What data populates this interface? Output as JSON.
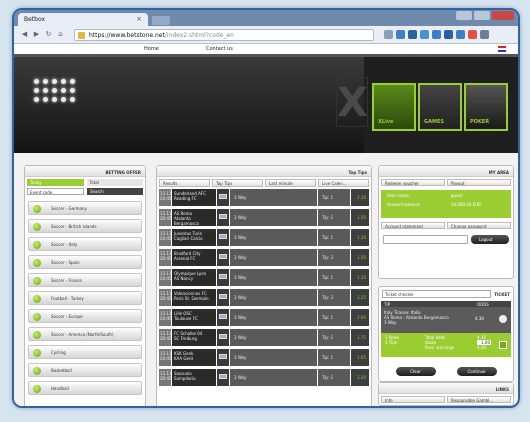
{
  "browser": {
    "tab_title": "Betbox",
    "url_host": "https://www.betstone.net",
    "url_path": "/index2.shtml?code_en"
  },
  "topnav": {
    "home": "Home",
    "contact": "Contact us"
  },
  "banner": {
    "promos": [
      "XLive",
      "GAMES",
      "POKER"
    ]
  },
  "left": {
    "title": "BETTING OFFER",
    "radio_on": "Today",
    "radio_off": "Total",
    "search_label": "Event code",
    "search_button": "Search",
    "sports": [
      "Soccer - Germany",
      "Soccer - British Islands",
      "Soccer - Italy",
      "Soccer - Spain",
      "Soccer - France",
      "Football - Turkey",
      "Soccer - Europe",
      "Soccer - America (North/South)",
      "Cycling",
      "Basketball",
      "Handball"
    ]
  },
  "middle": {
    "title": "Top Tips",
    "tabs": [
      "Results",
      "Top Tips",
      "Last minute",
      "Live Calen..."
    ],
    "matches": [
      {
        "date": "13.11.",
        "time": "20:45",
        "t1": "Sunderland AFC",
        "t2": "Reading FC",
        "sel": "3 Way",
        "tip": "Tip: 1",
        "odd": "2.10"
      },
      {
        "date": "13.11.",
        "time": "20:45",
        "t1": "AS Roma",
        "t2": "Atalanta Bergamasca",
        "sel": "3 Way",
        "tip": "Tip: 1",
        "odd": "1.50"
      },
      {
        "date": "13.11.",
        "time": "20:45",
        "t1": "Juventus Turin",
        "t2": "Cagliari Calcio",
        "sel": "3 Way",
        "tip": "Tip: 1",
        "odd": "1.30"
      },
      {
        "date": "13.11.",
        "time": "20:45",
        "t1": "Bradford City",
        "t2": "Arsenal FC",
        "sel": "3 Way",
        "tip": "Tip: 2",
        "odd": "1.50"
      },
      {
        "date": "13.11.",
        "time": "20:45",
        "t1": "Olympique Lyon",
        "t2": "AS Nancy",
        "sel": "3 Way",
        "tip": "Tip: 1",
        "odd": "1.35"
      },
      {
        "date": "13.11.",
        "time": "20:45",
        "t1": "Valenciennes FC",
        "t2": "Paris St. Germain",
        "sel": "3 Way",
        "tip": "Tip: 2",
        "odd": "2.25"
      },
      {
        "date": "13.11.",
        "time": "20:45",
        "t1": "Lille OSC",
        "t2": "Toulouse FC",
        "sel": "3 Way",
        "tip": "Tip: 1",
        "odd": "2.00"
      },
      {
        "date": "13.11.",
        "time": "20:45",
        "t1": "FC Schalke 04",
        "t2": "SC Freiburg",
        "sel": "3 Way",
        "tip": "Tip: 1",
        "odd": "1.75"
      },
      {
        "date": "13.11.",
        "time": "20:45",
        "t1": "KSK Genk",
        "t2": "KAA Gent",
        "sel": "3 Way",
        "tip": "Tip: 1",
        "odd": "1.65"
      },
      {
        "date": "13.11.",
        "time": "20:45",
        "t1": "Sassuolo",
        "t2": "Sampdoria",
        "sel": "3 Way",
        "tip": "Tip: 1",
        "odd": "2.20"
      }
    ]
  },
  "right": {
    "title": "MY AREA",
    "tabs": [
      "Redeem voucher",
      "Payout"
    ],
    "user_label": "User name",
    "user_value": "guest",
    "balance_label": "Account balance",
    "balance_value": "10,000.00 EUR",
    "tabs2": [
      "Account statement",
      "Change password"
    ],
    "logout": "Logout",
    "slip_input": "Ticket checker",
    "slip_title": "TICKET",
    "col_tip": "TIP",
    "col_odds": "ODDS",
    "bet_line1": "Italy Tirasse: Italia",
    "bet_line2": "AS Roma : Atalanta Bergamasca",
    "bet_line3": "3 Way",
    "bet_odd": "4.30",
    "sum_row1": [
      "1 Rows",
      "Total odds",
      "4.30"
    ],
    "sum_row2": [
      "1 Tips",
      "Stake",
      "1.00"
    ],
    "sum_row3": [
      "",
      "Poss. winnings",
      "4.30"
    ],
    "clear": "Clear",
    "continue": "Continue",
    "links_title": "LINKS",
    "links_tabs": [
      "Info",
      "Responsible Gambl..."
    ]
  }
}
